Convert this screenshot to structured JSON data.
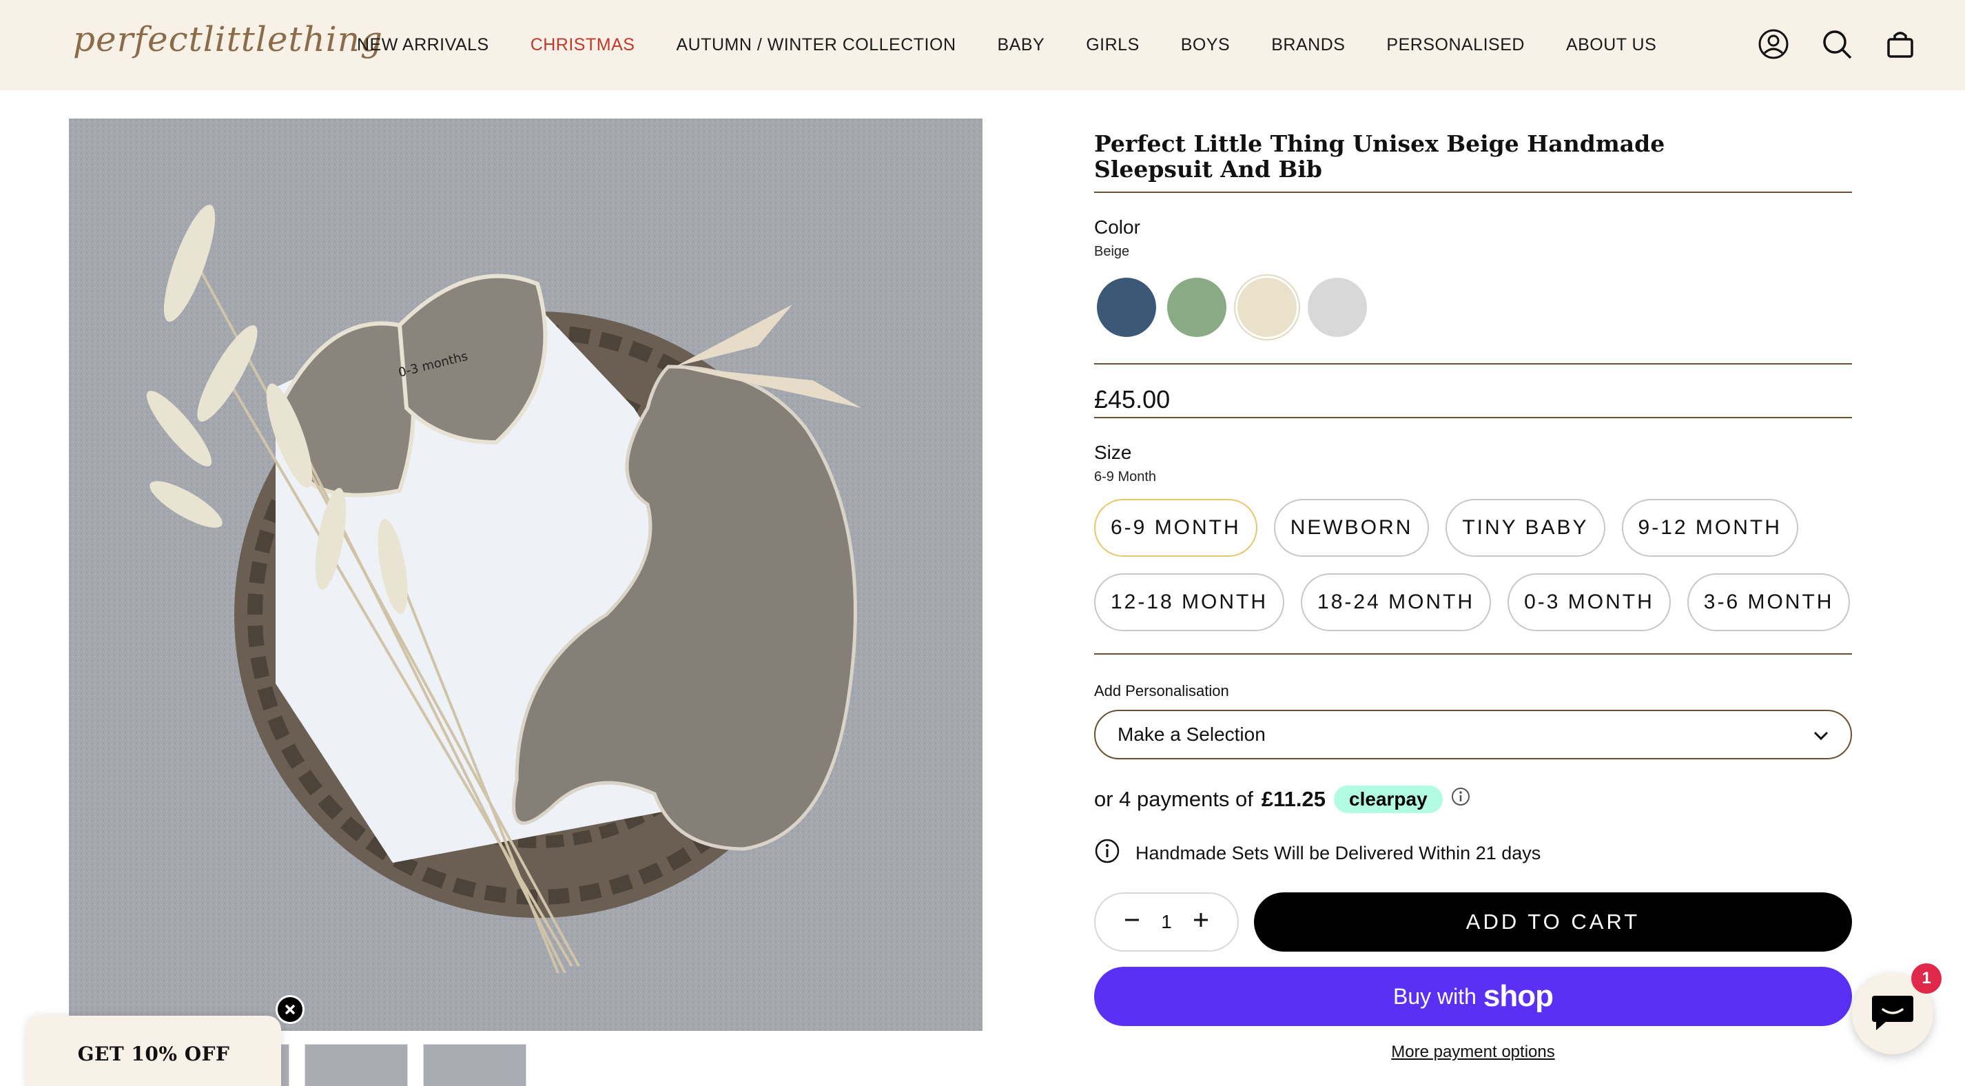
{
  "brand": {
    "logo_text": "perfectlittlething"
  },
  "nav": {
    "items": [
      {
        "label": "NEW ARRIVALS"
      },
      {
        "label": "CHRISTMAS"
      },
      {
        "label": "AUTUMN / WINTER COLLECTION"
      },
      {
        "label": "BABY"
      },
      {
        "label": "GIRLS"
      },
      {
        "label": "BOYS"
      },
      {
        "label": "BRANDS"
      },
      {
        "label": "PERSONALISED"
      },
      {
        "label": "ABOUT US"
      }
    ],
    "accent_color": "#c0392b"
  },
  "header_icons": [
    "account-icon",
    "search-icon",
    "cart-bag-icon"
  ],
  "product": {
    "title": "Perfect Little Thing Unisex Beige Handmade Sleepsuit And Bib",
    "color_label": "Color",
    "color_selected": "Beige",
    "swatches": [
      {
        "color": "#3b5876"
      },
      {
        "color": "#8aa985"
      },
      {
        "color": "#e9e1c9",
        "selected": true
      },
      {
        "color": "#d8d8d8"
      }
    ],
    "price": "£45.00",
    "size_label": "Size",
    "size_selected": "6-9 Month",
    "sizes": [
      {
        "label": "6-9 MONTH",
        "selected": true
      },
      {
        "label": "NEWBORN"
      },
      {
        "label": "TINY BABY"
      },
      {
        "label": "9-12 MONTH"
      },
      {
        "label": "12-18 MONTH"
      },
      {
        "label": "18-24 MONTH"
      },
      {
        "label": "0-3 MONTH"
      },
      {
        "label": "3-6 MONTH"
      }
    ],
    "personalisation_label": "Add Personalisation",
    "personalisation_value": "Make a Selection",
    "payments_prefix": "or 4 payments of",
    "payments_amount": "£11.25",
    "clearpay_label": "clearpay",
    "delivery_note": "Handmade Sets Will be Delivered Within 21 days",
    "quantity": "1",
    "add_to_cart": "ADD TO CART",
    "buy_with": "Buy with",
    "shop_label": "shop",
    "more_payment": "More payment options"
  },
  "image_label": "0-3 months",
  "promo": {
    "label": "GET 10% OFF"
  },
  "chat": {
    "badge": "1"
  },
  "colors": {
    "header_bg": "#f8f1e7",
    "rule": "#6b4f2e",
    "shop_pay": "#5a31f4",
    "clearpay": "#b2fce4"
  }
}
